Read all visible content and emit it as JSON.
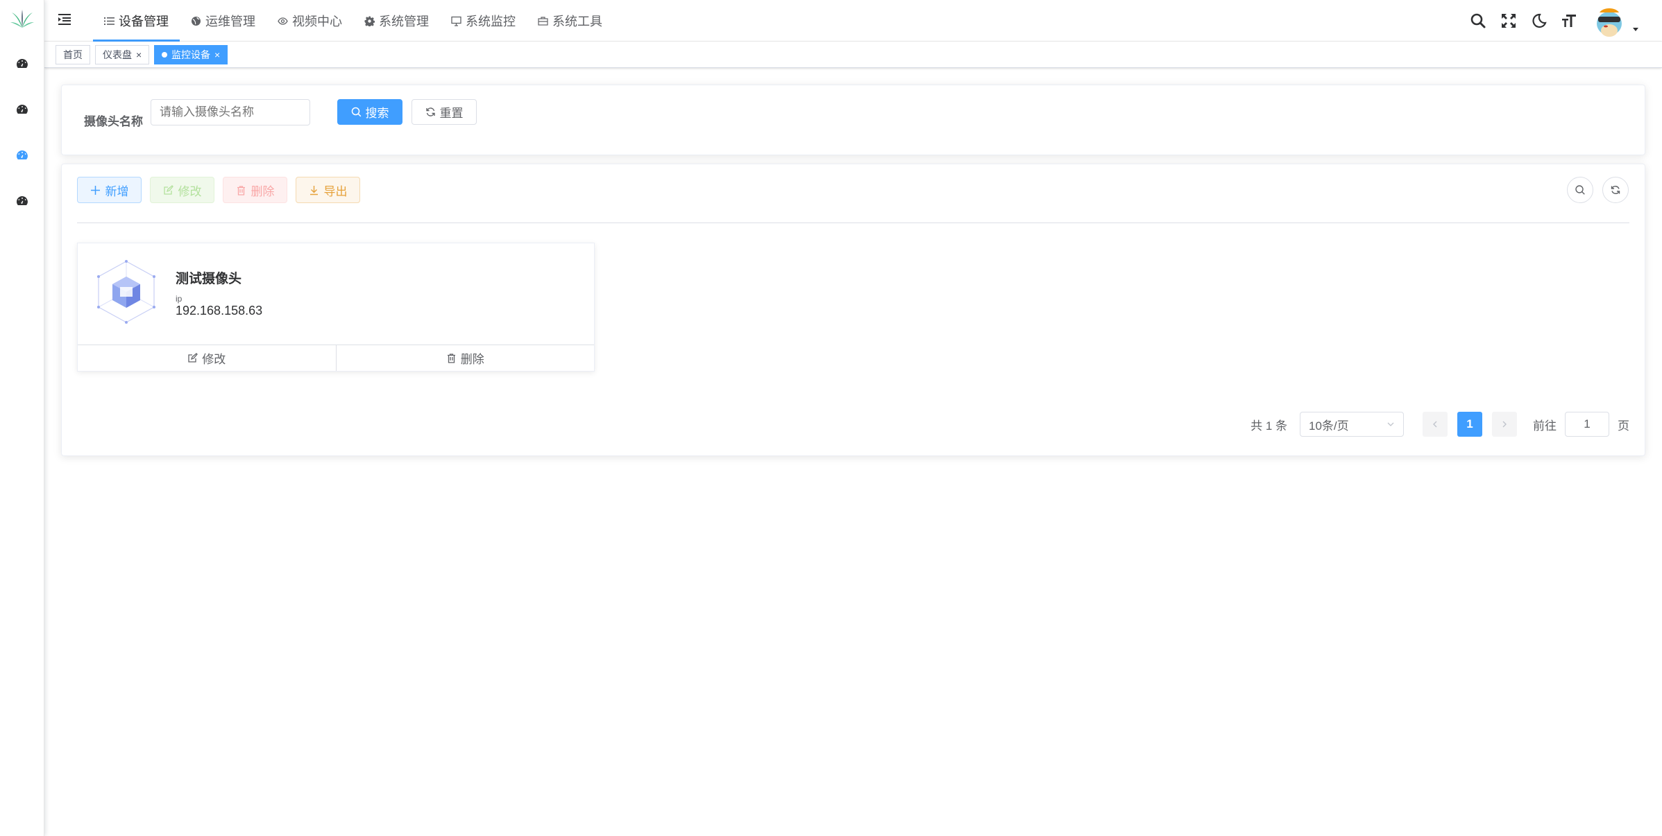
{
  "sidebar": {
    "logo_icon": "plant-logo-icon",
    "items": [
      {
        "icon": "dashboard-icon",
        "active": false
      },
      {
        "icon": "dashboard-icon",
        "active": false
      },
      {
        "icon": "dashboard-icon",
        "active": true
      },
      {
        "icon": "dashboard-icon",
        "active": false
      }
    ]
  },
  "topnav": {
    "items": [
      {
        "label": "设备管理",
        "icon": "list-icon",
        "active": true
      },
      {
        "label": "运维管理",
        "icon": "globe-icon",
        "active": false
      },
      {
        "label": "视频中心",
        "icon": "eye-icon",
        "active": false
      },
      {
        "label": "系统管理",
        "icon": "gear-icon",
        "active": false
      },
      {
        "label": "系统监控",
        "icon": "monitor-icon",
        "active": false
      },
      {
        "label": "系统工具",
        "icon": "toolbox-icon",
        "active": false
      }
    ],
    "tools": [
      "search-icon",
      "fullscreen-icon",
      "moon-icon",
      "font-size-icon"
    ]
  },
  "tags": [
    {
      "label": "首页",
      "closable": false,
      "active": false
    },
    {
      "label": "仪表盘",
      "closable": true,
      "active": false
    },
    {
      "label": "监控设备",
      "closable": true,
      "active": true
    }
  ],
  "search": {
    "label": "摄像头名称",
    "placeholder": "请输入摄像头名称",
    "search_btn": "搜索",
    "reset_btn": "重置"
  },
  "toolbar": {
    "add": "新增",
    "edit": "修改",
    "delete": "删除",
    "export": "导出"
  },
  "devices": [
    {
      "name": "测试摄像头",
      "ip_label": "ip",
      "ip": "192.168.158.63",
      "edit": "修改",
      "delete": "删除"
    }
  ],
  "pagination": {
    "total": "共 1 条",
    "page_size": "10条/页",
    "current_page": "1",
    "goto_label": "前往",
    "goto_value": "1",
    "page_unit": "页"
  },
  "colors": {
    "primary": "#409eff",
    "success_light": "#b3e19d",
    "danger_light": "#f9a7a7",
    "warning": "#e6a23c"
  }
}
